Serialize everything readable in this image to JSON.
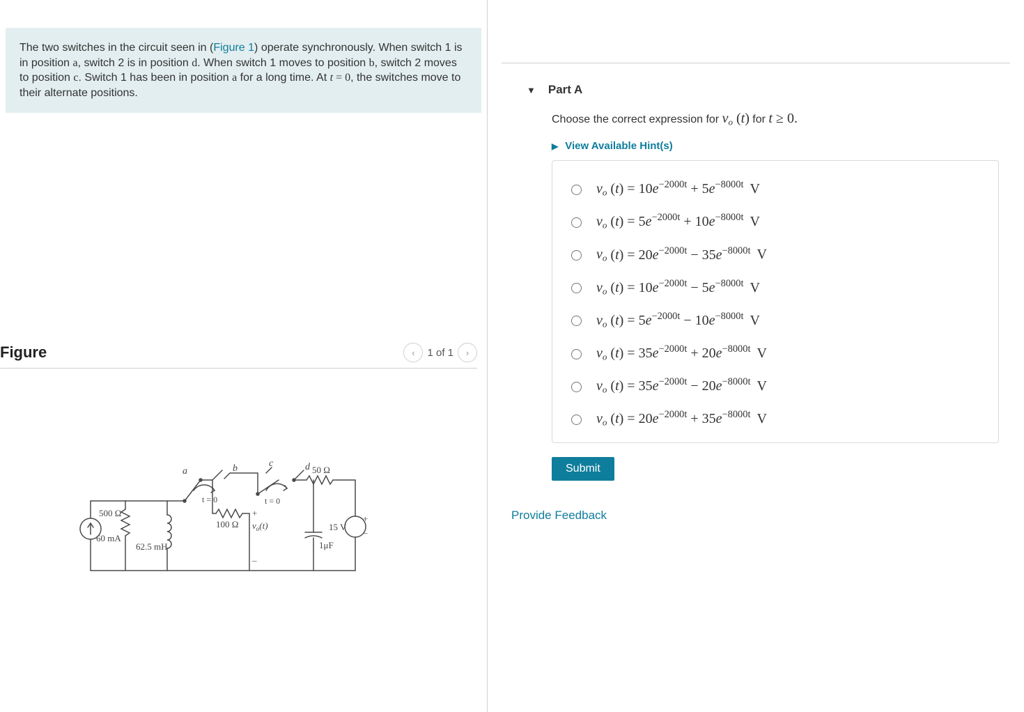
{
  "problem": {
    "text_pre": "The two switches in the circuit seen in (",
    "figure_link": "Figure 1",
    "text_post": ") operate synchronously. When switch 1 is in position a, switch 2 is in position d. When switch 1 moves to position b, switch 2 moves to position c. Switch 1 has been in position a for a long time. At t = 0, the switches move to their alternate positions."
  },
  "figure": {
    "title": "Figure",
    "pager": "1 of 1",
    "labels": {
      "a": "a",
      "b": "b",
      "c": "c",
      "d": "d",
      "t0_1": "t = 0",
      "t0_2": "t = 0",
      "r500": "500 Ω",
      "i60": "60 mA",
      "L": "62.5 mH",
      "r100": "100 Ω",
      "vo": "vₒ(t)",
      "plus": "+",
      "minus": "–",
      "r50": "50 Ω",
      "cap": "1μF",
      "v15": "15 V",
      "srcplus": "+",
      "srcminus": "–"
    }
  },
  "part": {
    "label": "Part A",
    "question_pre": "Choose the correct expression for ",
    "question_vo": "vₒ (t)",
    "question_mid": " for ",
    "question_cond": "t ≥ 0.",
    "hints_label": "View Available Hint(s)",
    "options": [
      {
        "a": "10",
        "e1": "−2000t",
        "op": "+",
        "b": "5",
        "e2": "−8000t"
      },
      {
        "a": "5",
        "e1": "−2000t",
        "op": "+",
        "b": "10",
        "e2": "−8000t"
      },
      {
        "a": "20",
        "e1": "−2000t",
        "op": "−",
        "b": "35",
        "e2": "−8000t"
      },
      {
        "a": "10",
        "e1": "−2000t",
        "op": "−",
        "b": "5",
        "e2": "−8000t"
      },
      {
        "a": "5",
        "e1": "−2000t",
        "op": "−",
        "b": "10",
        "e2": "−8000t"
      },
      {
        "a": "35",
        "e1": "−2000t",
        "op": "+",
        "b": "20",
        "e2": "−8000t"
      },
      {
        "a": "35",
        "e1": "−2000t",
        "op": "−",
        "b": "20",
        "e2": "−8000t"
      },
      {
        "a": "20",
        "e1": "−2000t",
        "op": "+",
        "b": "35",
        "e2": "−8000t"
      }
    ],
    "submit_label": "Submit"
  },
  "feedback_label": "Provide Feedback"
}
